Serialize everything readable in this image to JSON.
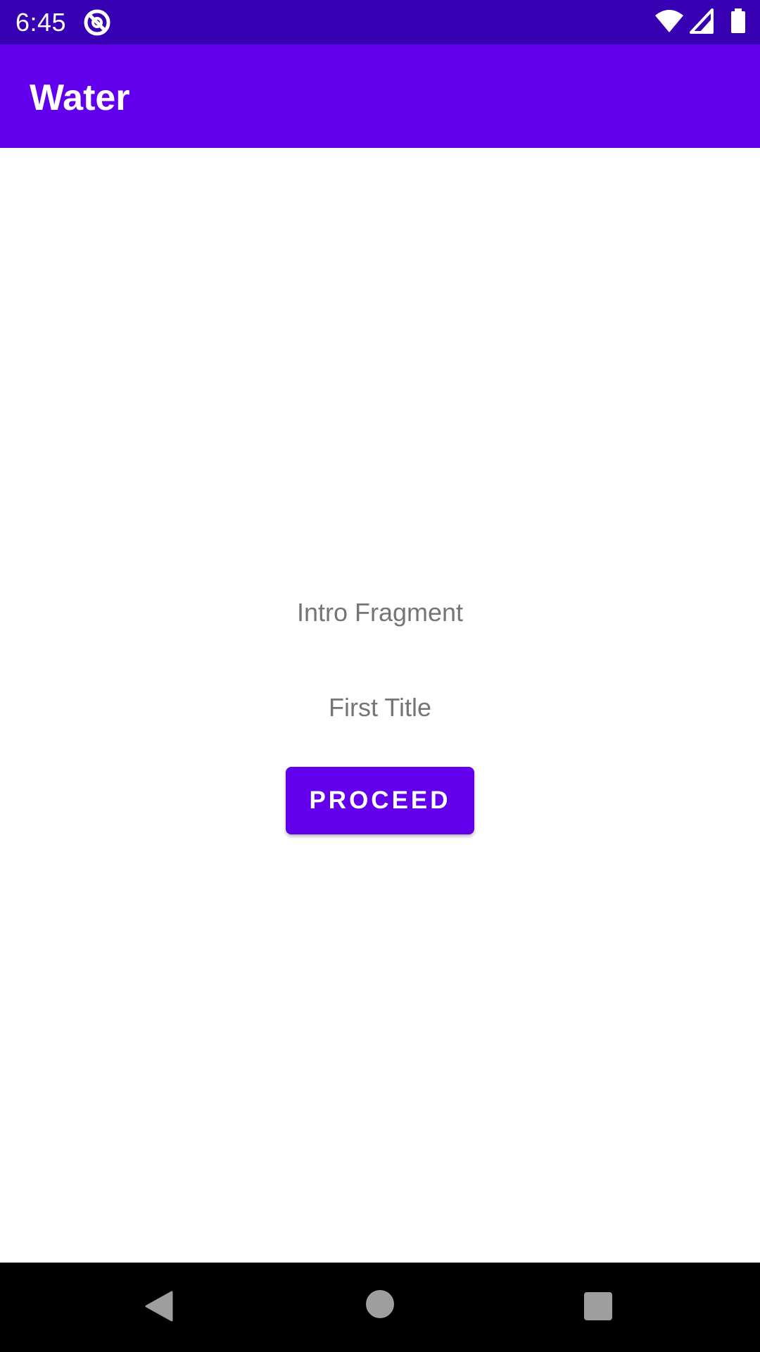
{
  "status_bar": {
    "time": "6:45",
    "app_icon": "app-notification-icon",
    "icons": [
      "wifi-icon",
      "cell-signal-icon",
      "battery-icon"
    ],
    "color": "#3700B3"
  },
  "app_bar": {
    "title": "Water",
    "color": "#6200EE"
  },
  "main": {
    "intro_text": "Intro Fragment",
    "first_title": "First Title",
    "proceed_label": "PROCEED",
    "button_color": "#6200EE"
  },
  "nav_bar": {
    "icons": [
      "back-icon",
      "home-icon",
      "recents-icon"
    ]
  }
}
